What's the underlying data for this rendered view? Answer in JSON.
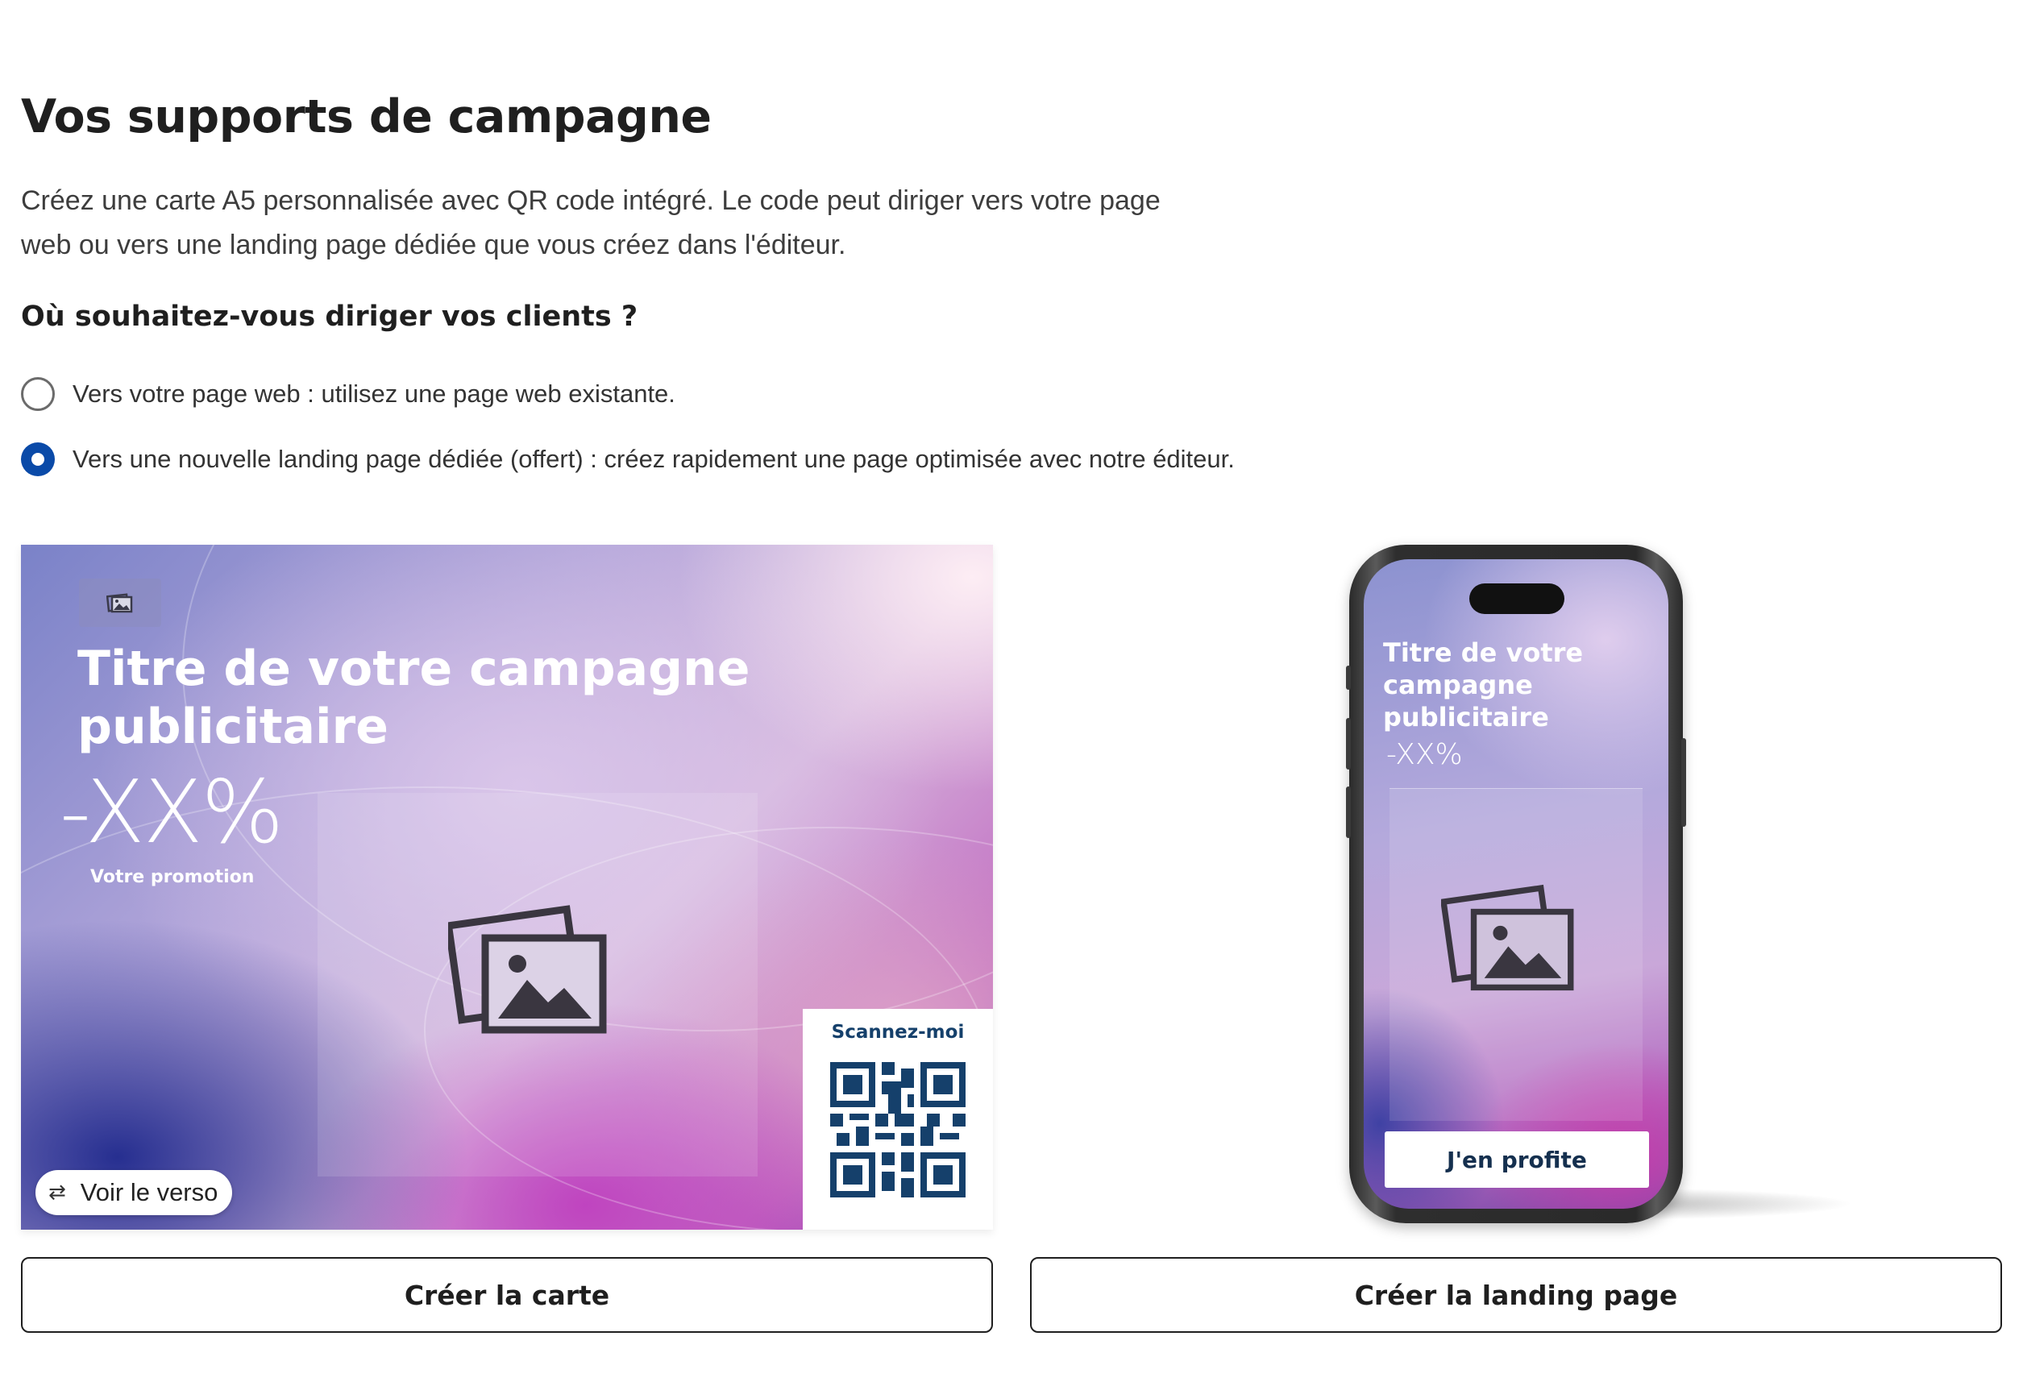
{
  "page": {
    "title": "Vos supports de campagne",
    "description": "Créez une carte A5 personnalisée avec QR code intégré. Le code peut diriger vers votre page web ou vers une landing page dédiée que vous créez dans l'éditeur.",
    "question": "Où souhaitez-vous diriger vos clients ?"
  },
  "options": [
    {
      "label": "Vers votre page web : utilisez une page web existante.",
      "checked": false
    },
    {
      "label": "Vers une nouvelle landing page dédiée (offert) : créez rapidement une page optimisée avec notre éditeur.",
      "checked": true
    }
  ],
  "card_preview": {
    "title": "Titre de votre campagne publicitaire",
    "discount": "-XX%",
    "promo_label": "Votre promotion",
    "qr_label": "Scannez-moi",
    "verso_button": "Voir le verso",
    "verso_icon": "swap-arrows-icon"
  },
  "phone_preview": {
    "title": "Titre de votre campagne publicitaire",
    "discount": "-XX%",
    "cta_label": "J'en profite"
  },
  "actions": {
    "create_card": "Créer la carte",
    "create_landing": "Créer la landing page"
  },
  "colors": {
    "accent": "#0a4aa8",
    "qr": "#15406b",
    "text": "#1f1f1f"
  }
}
